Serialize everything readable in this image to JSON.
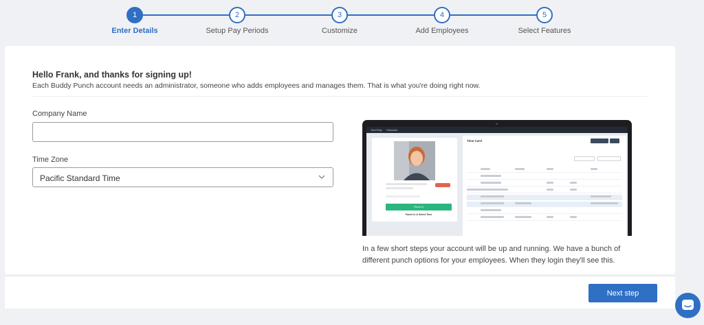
{
  "stepper": {
    "steps": [
      {
        "number": "1",
        "label": "Enter Details"
      },
      {
        "number": "2",
        "label": "Setup Pay Periods"
      },
      {
        "number": "3",
        "label": "Customize"
      },
      {
        "number": "4",
        "label": "Add Employees"
      },
      {
        "number": "5",
        "label": "Select Features"
      }
    ],
    "active_index": 0
  },
  "greeting": {
    "title": "Hello Frank, and thanks for signing up!",
    "subtitle": "Each Buddy Punch account needs an administrator, someone who adds employees and manages them. That is what you're doing right now."
  },
  "form": {
    "company_label": "Company Name",
    "company_value": "",
    "company_placeholder": "",
    "timezone_label": "Time Zone",
    "timezone_value": "Pacific Standard Time"
  },
  "preview": {
    "nav_tabs": [
      "Time Entry",
      "Timecards"
    ],
    "punch_button": "Punch In",
    "punch_link": "Punch In & Select Time",
    "timecard_title": "Time Card"
  },
  "description": "In a few short steps your account will be up and running. We have a bunch of different punch options for your employees. When they login they'll see this.",
  "footer": {
    "next_label": "Next step"
  },
  "colors": {
    "accent": "#2f6fc4",
    "punch_green": "#2cb67d",
    "page_bg": "#f0f1f4"
  },
  "icons": {
    "chat": "chat-bubble-icon",
    "dropdown": "chevron-down-icon"
  }
}
